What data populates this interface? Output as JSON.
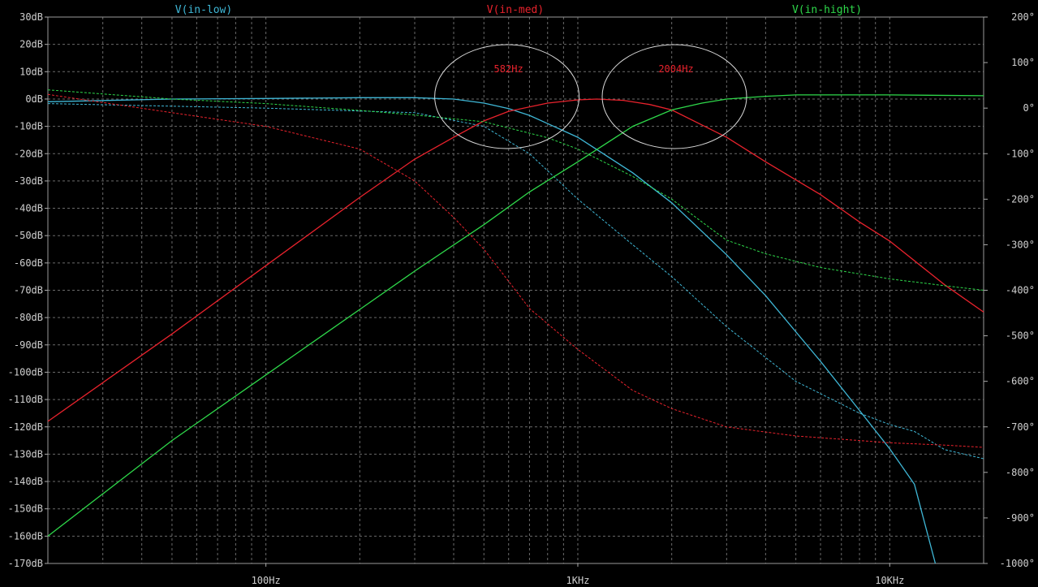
{
  "chart_data": {
    "type": "line",
    "title": "",
    "x_scale": "log",
    "xlim": [
      20,
      20000
    ],
    "ylim": [
      -170,
      30
    ],
    "ylim_right": [
      -1000,
      200
    ],
    "grid": true,
    "x_ticks": [
      {
        "value": 100,
        "label": "100Hz"
      },
      {
        "value": 1000,
        "label": "1KHz"
      },
      {
        "value": 10000,
        "label": "10KHz"
      }
    ],
    "y_ticks": [
      {
        "value": 30,
        "label": "30dB"
      },
      {
        "value": 20,
        "label": "20dB"
      },
      {
        "value": 10,
        "label": "10dB"
      },
      {
        "value": 0,
        "label": "0dB"
      },
      {
        "value": -10,
        "label": "-10dB"
      },
      {
        "value": -20,
        "label": "-20dB"
      },
      {
        "value": -30,
        "label": "-30dB"
      },
      {
        "value": -40,
        "label": "-40dB"
      },
      {
        "value": -50,
        "label": "-50dB"
      },
      {
        "value": -60,
        "label": "-60dB"
      },
      {
        "value": -70,
        "label": "-70dB"
      },
      {
        "value": -80,
        "label": "-80dB"
      },
      {
        "value": -90,
        "label": "-90dB"
      },
      {
        "value": -100,
        "label": "-100dB"
      },
      {
        "value": -110,
        "label": "-110dB"
      },
      {
        "value": -120,
        "label": "-120dB"
      },
      {
        "value": -130,
        "label": "-130dB"
      },
      {
        "value": -140,
        "label": "-140dB"
      },
      {
        "value": -150,
        "label": "-150dB"
      },
      {
        "value": -160,
        "label": "-160dB"
      },
      {
        "value": -170,
        "label": "-170dB"
      }
    ],
    "y_ticks_right": [
      {
        "value": 200,
        "label": "200°"
      },
      {
        "value": 100,
        "label": "100°"
      },
      {
        "value": 0,
        "label": "0°"
      },
      {
        "value": -100,
        "label": "-100°"
      },
      {
        "value": -200,
        "label": "-200°"
      },
      {
        "value": -300,
        "label": "-300°"
      },
      {
        "value": -400,
        "label": "-400°"
      },
      {
        "value": -500,
        "label": "-500°"
      },
      {
        "value": -600,
        "label": "-600°"
      },
      {
        "value": -700,
        "label": "-700°"
      },
      {
        "value": -800,
        "label": "-800°"
      },
      {
        "value": -900,
        "label": "-900°"
      },
      {
        "value": -1000,
        "label": "-1000°"
      }
    ],
    "series": [
      {
        "name": "V(in-low)",
        "color": "#3fb7d6",
        "x": [
          20,
          50,
          100,
          200,
          300,
          400,
          500,
          600,
          700,
          800,
          1000,
          1500,
          2000,
          3000,
          4000,
          6000,
          8000,
          10000,
          12000,
          14000
        ],
        "magnitude_db": [
          -1,
          0,
          0.2,
          0.5,
          0.5,
          0,
          -1.5,
          -3.5,
          -6,
          -9,
          -14,
          -27,
          -38,
          -57,
          -72,
          -96,
          -114,
          -128,
          -141,
          -170
        ],
        "phase_x": [
          20,
          100,
          300,
          500,
          700,
          1000,
          1500,
          2000,
          3000,
          5000,
          8000,
          10000,
          12000,
          15000,
          20000
        ],
        "phase_deg": [
          10,
          0,
          -10,
          -40,
          -100,
          -200,
          -300,
          -370,
          -480,
          -600,
          -670,
          -695,
          -710,
          -750,
          -770
        ]
      },
      {
        "name": "V(in-med)",
        "color": "#e8222c",
        "x": [
          20,
          50,
          100,
          200,
          300,
          400,
          500,
          600,
          800,
          1000,
          1150,
          1400,
          1700,
          2000,
          3000,
          4000,
          6000,
          8000,
          10000,
          15000,
          20000
        ],
        "magnitude_db": [
          -118,
          -86,
          -61,
          -36,
          -22,
          -14,
          -8,
          -4.5,
          -1.5,
          -0.3,
          0,
          -0.5,
          -2,
          -4,
          -14,
          -23,
          -35,
          -45,
          -52,
          -68,
          -78
        ],
        "phase_x": [
          20,
          50,
          100,
          200,
          300,
          400,
          500,
          700,
          1000,
          1500,
          2000,
          3000,
          5000,
          8000,
          10000,
          15000,
          20000
        ],
        "phase_deg": [
          30,
          -10,
          -40,
          -90,
          -160,
          -240,
          -310,
          -440,
          -530,
          -620,
          -660,
          -700,
          -720,
          -730,
          -735,
          -740,
          -745
        ]
      },
      {
        "name": "V(in-hight)",
        "color": "#2ed84a",
        "x": [
          20,
          50,
          100,
          200,
          300,
          500,
          700,
          1000,
          1500,
          2000,
          2500,
          3000,
          4000,
          5000,
          8000,
          10000,
          20000
        ],
        "magnitude_db": [
          -160,
          -125,
          -101,
          -77,
          -63,
          -46,
          -34,
          -23,
          -10,
          -4,
          -1.5,
          0,
          1,
          1.5,
          1.5,
          1.5,
          1.2
        ],
        "phase_x": [
          20,
          50,
          100,
          200,
          300,
          500,
          800,
          1000,
          1500,
          2000,
          2500,
          3000,
          4000,
          6000,
          10000,
          15000,
          20000
        ],
        "phase_deg": [
          40,
          20,
          10,
          -5,
          -15,
          -30,
          -65,
          -90,
          -150,
          -200,
          -250,
          -290,
          -320,
          -350,
          -375,
          -390,
          -400
        ]
      }
    ],
    "annotations": [
      {
        "text": "582Hz",
        "color": "#e8222c",
        "cx": 582,
        "cy": 0
      },
      {
        "text": "2004Hz",
        "color": "#e8222c",
        "cx": 2004,
        "cy": 0
      }
    ]
  }
}
